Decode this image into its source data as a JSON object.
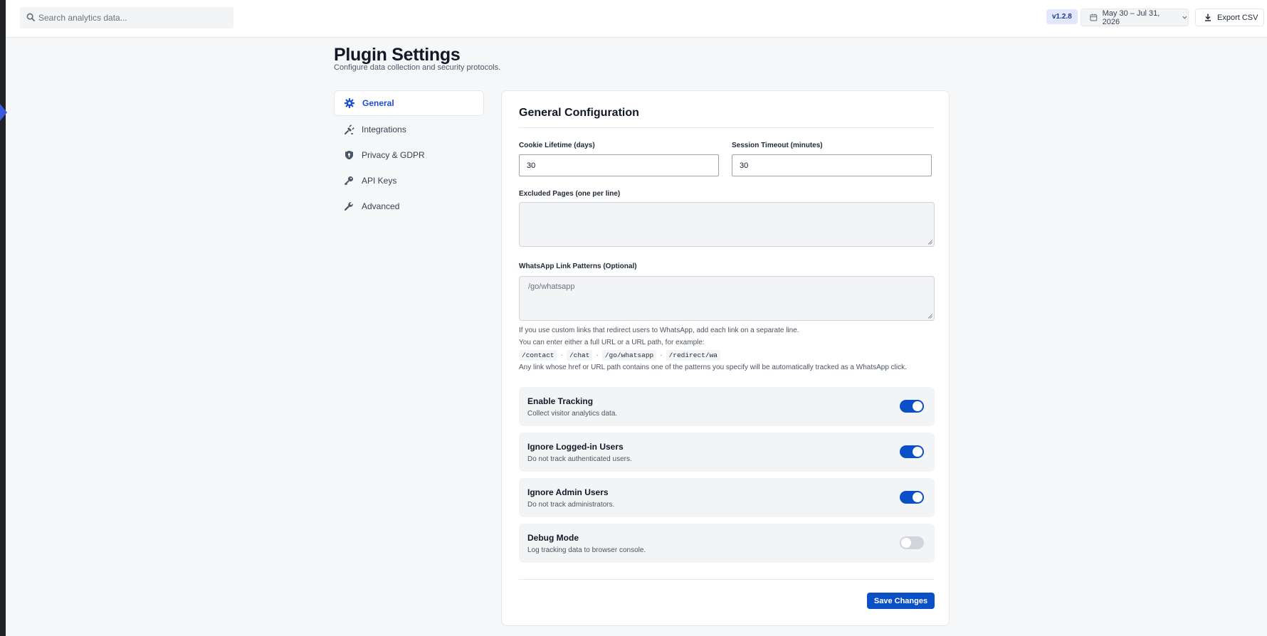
{
  "search": {
    "placeholder": "Search analytics data..."
  },
  "header": {
    "version": "v1.2.8",
    "date_range": "May 30 – Jul 31, 2026",
    "export_label": "Export CSV"
  },
  "page": {
    "title": "Plugin Settings",
    "subtitle": "Configure data collection and security protocols."
  },
  "nav": {
    "items": [
      {
        "label": "General",
        "icon": "gear-icon",
        "active": true
      },
      {
        "label": "Integrations",
        "icon": "plug-icon",
        "active": false
      },
      {
        "label": "Privacy & GDPR",
        "icon": "shield-icon",
        "active": false
      },
      {
        "label": "API Keys",
        "icon": "key-icon",
        "active": false
      },
      {
        "label": "Advanced",
        "icon": "wrench-icon",
        "active": false
      }
    ]
  },
  "panel": {
    "title": "General Configuration",
    "cookie_label": "Cookie Lifetime (days)",
    "cookie_value": "30",
    "session_label": "Session Timeout (minutes)",
    "session_value": "30",
    "excluded_label": "Excluded Pages (one per line)",
    "excluded_value": "",
    "whatsapp_label": "WhatsApp Link Patterns (Optional)",
    "whatsapp_placeholder": "/go/whatsapp",
    "help_line1": "If you use custom links that redirect users to WhatsApp, add each link on a separate line.",
    "help_line2": "You can enter either a full URL or a URL path, for example:",
    "help_codes": [
      "/contact",
      "/chat",
      "/go/whatsapp",
      "/redirect/wa"
    ],
    "help_separator": "·",
    "help_line3": "Any link whose href or URL path contains one of the patterns you specify will be automatically tracked as a WhatsApp click.",
    "toggles": [
      {
        "title": "Enable Tracking",
        "desc": "Collect visitor analytics data.",
        "on": true
      },
      {
        "title": "Ignore Logged-in Users",
        "desc": "Do not track authenticated users.",
        "on": true
      },
      {
        "title": "Ignore Admin Users",
        "desc": "Do not track administrators.",
        "on": true
      },
      {
        "title": "Debug Mode",
        "desc": "Log tracking data to browser console.",
        "on": false
      }
    ],
    "save_label": "Save Changes"
  },
  "colors": {
    "accent": "#0b4fc7",
    "active_nav_text": "#1d4ed8",
    "version_badge_bg": "#e0e7ff"
  }
}
